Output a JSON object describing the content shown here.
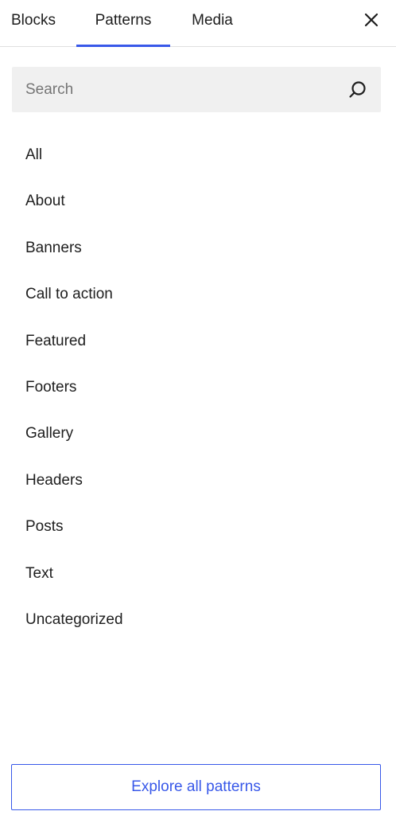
{
  "tabs": {
    "blocks": "Blocks",
    "patterns": "Patterns",
    "media": "Media",
    "active": "Patterns"
  },
  "close": {
    "icon": "close-icon"
  },
  "search": {
    "placeholder": "Search",
    "value": "",
    "icon": "search-icon"
  },
  "categories": [
    {
      "label": "All"
    },
    {
      "label": "About"
    },
    {
      "label": "Banners"
    },
    {
      "label": "Call to action"
    },
    {
      "label": "Featured"
    },
    {
      "label": "Footers"
    },
    {
      "label": "Gallery"
    },
    {
      "label": "Headers"
    },
    {
      "label": "Posts"
    },
    {
      "label": "Text"
    },
    {
      "label": "Uncategorized"
    }
  ],
  "footer": {
    "explore_label": "Explore all patterns"
  },
  "colors": {
    "accent": "#3858e9",
    "text": "#1e1e1e",
    "search_bg": "#f0f0f0",
    "placeholder": "#757575",
    "divider": "#e0e0e0"
  }
}
